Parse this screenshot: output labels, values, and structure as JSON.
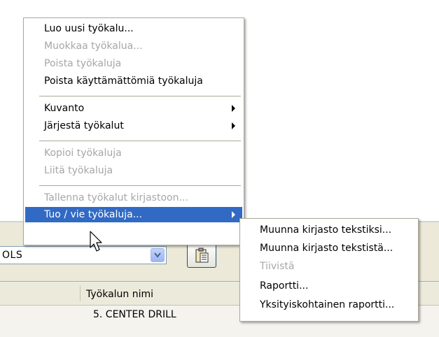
{
  "context_menu": {
    "items": [
      {
        "label": "Luo uusi työkalu...",
        "disabled": false
      },
      {
        "label": "Muokkaa työkalua...",
        "disabled": true
      },
      {
        "label": "Poista työkaluja",
        "disabled": true
      },
      {
        "label": "Poista käyttämättömiä työkaluja",
        "disabled": false
      },
      {
        "label": "Kuvanto",
        "disabled": false,
        "submenu": true
      },
      {
        "label": "Järjestä työkalut",
        "disabled": false,
        "submenu": true
      },
      {
        "label": "Kopioi työkaluja",
        "disabled": true
      },
      {
        "label": "Liitä työkaluja",
        "disabled": true
      },
      {
        "label": "Tallenna työkalut kirjastoon...",
        "disabled": true
      },
      {
        "label": "Tuo / vie työkaluja...",
        "disabled": false,
        "submenu": true,
        "selected": true
      }
    ]
  },
  "submenu": {
    "items": [
      {
        "label": "Muunna kirjasto tekstiksi...",
        "disabled": false
      },
      {
        "label": "Muunna kirjasto tekstistä...",
        "disabled": false
      },
      {
        "label": "Tiivistä",
        "disabled": true
      },
      {
        "label": "Raportti...",
        "disabled": false
      },
      {
        "label": "Yksityiskohtainen raportti...",
        "disabled": false
      }
    ]
  },
  "toolbar": {
    "combo_value": "OLS",
    "combo_icon": "chevron-down-icon",
    "tool_button_icon": "clipboard-paste-icon"
  },
  "grid": {
    "column_header": "Työkalun nimi",
    "rows": [
      "5. CENTER DRILL"
    ]
  },
  "colors": {
    "selection": "#316ac5",
    "disabled_text": "#a7a6aa",
    "toolbar_bg": "#ece9d8"
  }
}
